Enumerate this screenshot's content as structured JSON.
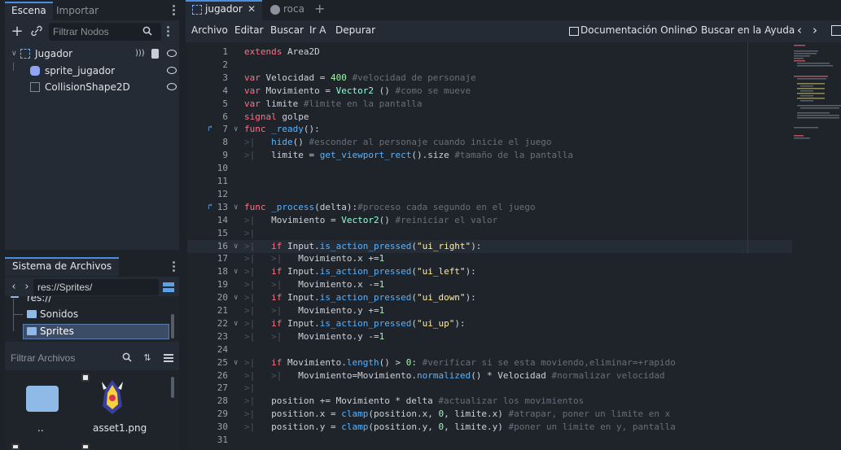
{
  "scene_dock": {
    "tabs": [
      "Escena",
      "Importar"
    ],
    "filter_placeholder": "Filtrar Nodos",
    "nodes": [
      "Jugador",
      "sprite_jugador",
      "CollisionShape2D"
    ]
  },
  "filesystem_dock": {
    "title": "Sistema de Archivos",
    "path": "res://Sprites/",
    "tree": [
      "res://",
      "Sonidos",
      "Sprites"
    ],
    "filter_placeholder": "Filtrar Archivos",
    "files": [
      "..",
      "asset1.png"
    ]
  },
  "editor": {
    "tabs": [
      "jugador",
      "roca"
    ],
    "add_tab": "+",
    "menu": [
      "Archivo",
      "Editar",
      "Buscar",
      "Ir A",
      "Depurar"
    ],
    "online_docs": "Documentación Online",
    "search_help": "Buscar en la Ayuda",
    "current_line": 16,
    "code": [
      {
        "n": 1,
        "html": "<span class='kw'>extends</span> Area2D"
      },
      {
        "n": 2,
        "html": ""
      },
      {
        "n": 3,
        "html": "<span class='kw'>var</span> Velocidad = <span class='num'>400</span> <span class='cmt'>#velocidad de personaje</span>"
      },
      {
        "n": 4,
        "html": "<span class='kw'>var</span> Movimiento = <span class='ty'>Vector2</span> () <span class='cmt'>#como se mueve</span>"
      },
      {
        "n": 5,
        "html": "<span class='kw'>var</span> limite <span class='cmt'>#limite en la pantalla</span>"
      },
      {
        "n": 6,
        "html": "<span class='kw'>signal</span> golpe"
      },
      {
        "n": 7,
        "html": "<span class='kw'>func</span> <span class='fn'>_ready</span>():",
        "icon": true,
        "fold": true
      },
      {
        "n": 8,
        "html": "<span class='tabmark'>&gt;|</span>   <span class='fn'>hide</span>() <span class='cmt'>#esconder al personaje cuando inicie el juego</span>"
      },
      {
        "n": 9,
        "html": "<span class='tabmark'>&gt;|</span>   limite = <span class='fn'>get_viewport_rect</span>().size <span class='cmt'>#tamaño de la pantalla</span>"
      },
      {
        "n": 10,
        "html": ""
      },
      {
        "n": 11,
        "html": ""
      },
      {
        "n": 12,
        "html": ""
      },
      {
        "n": 13,
        "html": "<span class='kw'>func</span> <span class='fn'>_process</span>(delta):<span class='cmt'>#proceso cada segundo en el juego</span>",
        "icon": true,
        "fold": true
      },
      {
        "n": 14,
        "html": "<span class='tabmark'>&gt;|</span>   Movimiento = <span class='ty'>Vector2</span>() <span class='cmt'>#reiniciar el valor</span>"
      },
      {
        "n": 15,
        "html": "<span class='tabmark'>&gt;|</span>"
      },
      {
        "n": 16,
        "html": "<span class='tabmark'>&gt;|</span>   <span class='kw'>if</span> Input.<span class='fn'>is_action_pressed</span>(<span class='str'>\"ui_right\"</span>):",
        "fold": true
      },
      {
        "n": 17,
        "html": "<span class='tabmark'>&gt;|</span>   <span class='tabmark'>&gt;|</span>   Movimiento.x +=<span class='num'>1</span>"
      },
      {
        "n": 18,
        "html": "<span class='tabmark'>&gt;|</span>   <span class='kw'>if</span> Input.<span class='fn'>is_action_pressed</span>(<span class='str'>\"ui_left\"</span>):",
        "fold": true
      },
      {
        "n": 19,
        "html": "<span class='tabmark'>&gt;|</span>   <span class='tabmark'>&gt;|</span>   Movimiento.x -=<span class='num'>1</span>"
      },
      {
        "n": 20,
        "html": "<span class='tabmark'>&gt;|</span>   <span class='kw'>if</span> Input.<span class='fn'>is_action_pressed</span>(<span class='str'>\"ui_down\"</span>):",
        "fold": true
      },
      {
        "n": 21,
        "html": "<span class='tabmark'>&gt;|</span>   <span class='tabmark'>&gt;|</span>   Movimiento.y +=<span class='num'>1</span>"
      },
      {
        "n": 22,
        "html": "<span class='tabmark'>&gt;|</span>   <span class='kw'>if</span> Input.<span class='fn'>is_action_pressed</span>(<span class='str'>\"ui_up\"</span>):",
        "fold": true
      },
      {
        "n": 23,
        "html": "<span class='tabmark'>&gt;|</span>   <span class='tabmark'>&gt;|</span>   Movimiento.y -=<span class='num'>1</span>"
      },
      {
        "n": 24,
        "html": ""
      },
      {
        "n": 25,
        "html": "<span class='tabmark'>&gt;|</span>   <span class='kw'>if</span> Movimiento.<span class='fn'>length</span>() &gt; <span class='num'>0</span>: <span class='cmt'>#verificar si se esta moviendo,eliminar=+rapido</span>",
        "fold": true
      },
      {
        "n": 26,
        "html": "<span class='tabmark'>&gt;|</span>   <span class='tabmark'>&gt;|</span>   Movimiento=Movimiento.<span class='fn'>normalized</span>() * Velocidad <span class='cmt'>#normalizar velocidad</span>"
      },
      {
        "n": 27,
        "html": "<span class='tabmark'>&gt;|</span>"
      },
      {
        "n": 28,
        "html": "<span class='tabmark'>&gt;|</span>   position += Movimiento * delta <span class='cmt'>#actualizar los movimientos</span>"
      },
      {
        "n": 29,
        "html": "<span class='tabmark'>&gt;|</span>   position.x = <span class='fn'>clamp</span>(position.x, <span class='num'>0</span>, limite.x) <span class='cmt'>#atrapar, poner un limite en x</span>"
      },
      {
        "n": 30,
        "html": "<span class='tabmark'>&gt;|</span>   position.y = <span class='fn'>clamp</span>(position.y, <span class='num'>0</span>, limite.y) <span class='cmt'>#poner un limite en y, pantalla</span>"
      },
      {
        "n": 31,
        "html": ""
      }
    ]
  }
}
